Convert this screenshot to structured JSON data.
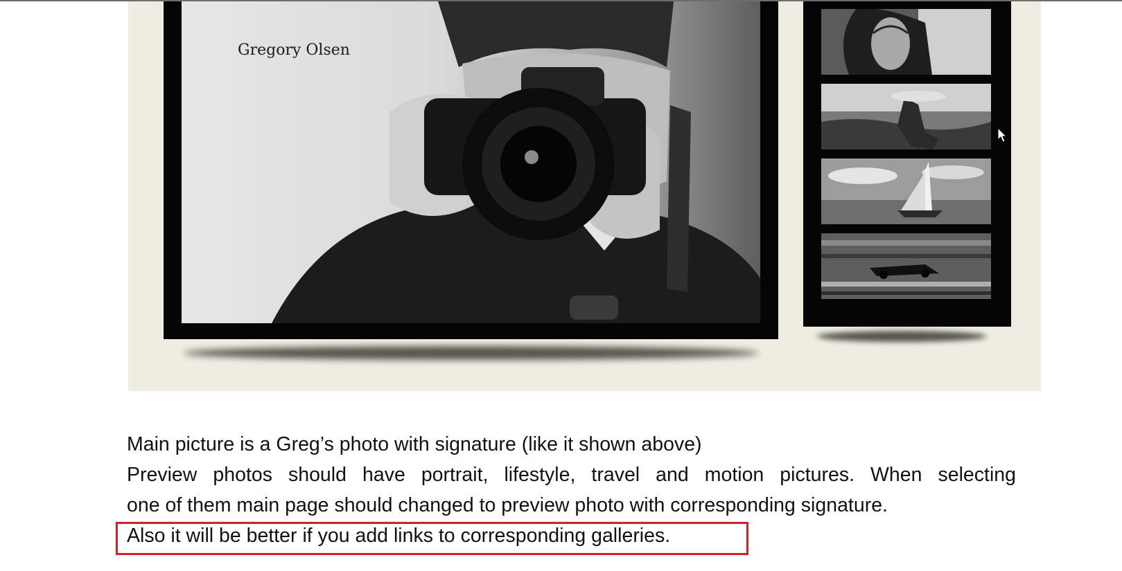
{
  "mockup": {
    "main_picture": {
      "signature": "Gregory Olsen",
      "image": "photographer-with-camera"
    },
    "preview_photos": [
      {
        "image": "portrait-woman"
      },
      {
        "image": "fountain-statue"
      },
      {
        "image": "sailboat"
      },
      {
        "image": "motion-race-car"
      }
    ]
  },
  "description": {
    "lines": [
      "Main picture is a Greg’s photo with signature (like it shown above)",
      "Preview photos should have portrait, lifestyle, travel and motion pictures. When selecting",
      "one of them main page should changed to preview photo with corresponding signature.",
      "Also it will be better if you add links to corresponding galleries."
    ]
  },
  "colors": {
    "mockup_background": "#efede2",
    "frame": "#050505",
    "highlight_border": "#d0202a"
  }
}
